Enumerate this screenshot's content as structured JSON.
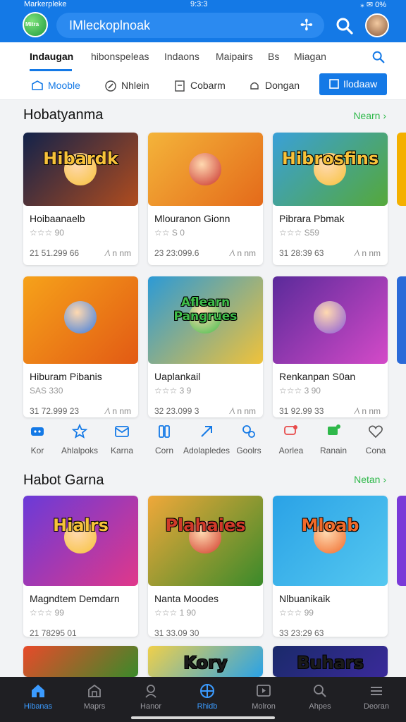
{
  "status": {
    "carrier": "Markerpleke",
    "time": "9:3:3",
    "right": "⁎ ✉ 0%"
  },
  "app": {
    "logo_text": "Mitra",
    "search_text": "IMleckoplnoak"
  },
  "tabs": [
    {
      "label": "Indaugan",
      "active": true
    },
    {
      "label": "hibonspeleas",
      "active": false
    },
    {
      "label": "Indaons",
      "active": false
    },
    {
      "label": "Maipairs",
      "active": false
    },
    {
      "label": "Bs",
      "active": false
    },
    {
      "label": "Miagan",
      "active": false
    }
  ],
  "filters": [
    {
      "label": "Mooble",
      "icon": "box-icon"
    },
    {
      "label": "Nhlein",
      "icon": "pen-icon"
    },
    {
      "label": "Cobarm",
      "icon": "card-icon"
    },
    {
      "label": "Dongan",
      "icon": "bell-icon"
    },
    {
      "label": "Ilodaaw",
      "icon": "book-icon",
      "active": true
    }
  ],
  "section1": {
    "title": "Hobatyanma",
    "more": "Nearn ›",
    "cards": [
      {
        "title": "Hoibaanaelb",
        "rating": "☆☆☆ 90",
        "count": "21 51.299 66",
        "meta": "∕\\ n nm",
        "art_text": "Hibardk",
        "colors": [
          "#12224a",
          "#b04c1e"
        ],
        "accent": "#f7c23a"
      },
      {
        "title": "Mlouranon Gionn",
        "rating": "☆☆ S 0",
        "count": "23 23:099.6",
        "meta": "∕\\ n nm",
        "art_text": "",
        "colors": [
          "#f4b43a",
          "#e46a1a"
        ],
        "accent": "#c9312b"
      },
      {
        "title": "Pibrara Pbmak",
        "rating": "☆☆☆ S59",
        "count": "31 28:39 63",
        "meta": "∕\\ n nm",
        "art_text": "Hibrosfins",
        "colors": [
          "#3aa0d8",
          "#55a83a"
        ],
        "accent": "#f7c23a"
      },
      {
        "title": "Hiburam Pibanis",
        "rating": "SAS 330",
        "count": "31 72.999 23",
        "meta": "∕\\ n nm",
        "art_text": "",
        "colors": [
          "#f6a21a",
          "#e25a14"
        ],
        "accent": "#3a7be0"
      },
      {
        "title": "Uaplankail",
        "rating": "☆☆☆ 3 9",
        "count": "32 23.099 3",
        "meta": "∕\\ n nm",
        "art_text": "Aflearn Pangrues",
        "colors": [
          "#2c9ad6",
          "#f0c23a"
        ],
        "accent": "#3fbf4a"
      },
      {
        "title": "Renkanpan S0an",
        "rating": "☆☆☆ 3 90",
        "count": "31 92.99 33",
        "meta": "∕\\ n nm",
        "art_text": "",
        "colors": [
          "#5a2a9a",
          "#d44ac8"
        ],
        "accent": "#8a5ad8"
      }
    ]
  },
  "categories": [
    {
      "label": "Kor",
      "icon": "controller-icon"
    },
    {
      "label": "Ahlalpoks",
      "icon": "star-icon"
    },
    {
      "label": "Karna",
      "icon": "mail-icon"
    },
    {
      "label": "Corn",
      "icon": "cards-icon"
    },
    {
      "label": "Adolapledes",
      "icon": "arrow-icon"
    },
    {
      "label": "Goolrs",
      "icon": "puzzle-icon"
    },
    {
      "label": "Aorlea",
      "icon": "chat-icon"
    },
    {
      "label": "Ranain",
      "icon": "flag-icon"
    },
    {
      "label": "Cona",
      "icon": "heart-icon"
    }
  ],
  "section2": {
    "title": "Habot Garna",
    "more": "Netan ›",
    "cards": [
      {
        "title": "Magndtem Demdarn",
        "rating": "☆☆☆ 99",
        "count": "21 78295 01",
        "meta": "",
        "art_text": "Hialrs",
        "colors": [
          "#6a3ad8",
          "#e0388a"
        ],
        "accent": "#f7c23a"
      },
      {
        "title": "Nanta Moodes",
        "rating": "☆☆☆ 1 90",
        "count": "31 33.09 30",
        "meta": "",
        "art_text": "Plahaies",
        "colors": [
          "#f0a83a",
          "#3a8a2a"
        ],
        "accent": "#d03a2a"
      },
      {
        "title": "Nlbuanikaik",
        "rating": "☆☆☆ 99",
        "count": "33 23:29 63",
        "meta": "",
        "art_text": "Mloab",
        "colors": [
          "#2aa2e6",
          "#55c8f0"
        ],
        "accent": "#f06a2a"
      }
    ]
  },
  "peek": [
    {
      "art_text": "",
      "colors": [
        "#e84a2a",
        "#3a8a2a"
      ]
    },
    {
      "art_text": "Kory",
      "colors": [
        "#f0d04a",
        "#2aa2e6"
      ]
    },
    {
      "art_text": "Buhars",
      "colors": [
        "#1a2a6a",
        "#3a2a9a"
      ]
    }
  ],
  "bottom_nav": [
    {
      "label": "Hibanas",
      "icon": "home-icon",
      "active": true
    },
    {
      "label": "Maprs",
      "icon": "store-icon",
      "active": false
    },
    {
      "label": "Hanor",
      "icon": "user-icon",
      "active": false
    },
    {
      "label": "Rhidb",
      "icon": "grid-icon",
      "active": true
    },
    {
      "label": "Molron",
      "icon": "play-icon",
      "active": false
    },
    {
      "label": "Ahpes",
      "icon": "search-icon",
      "active": false
    },
    {
      "label": "Deoran",
      "icon": "menu-icon",
      "active": false
    }
  ],
  "colors": {
    "primary": "#1479e6",
    "accent_green": "#2fb84a",
    "nav_bg": "#1f1f23"
  }
}
